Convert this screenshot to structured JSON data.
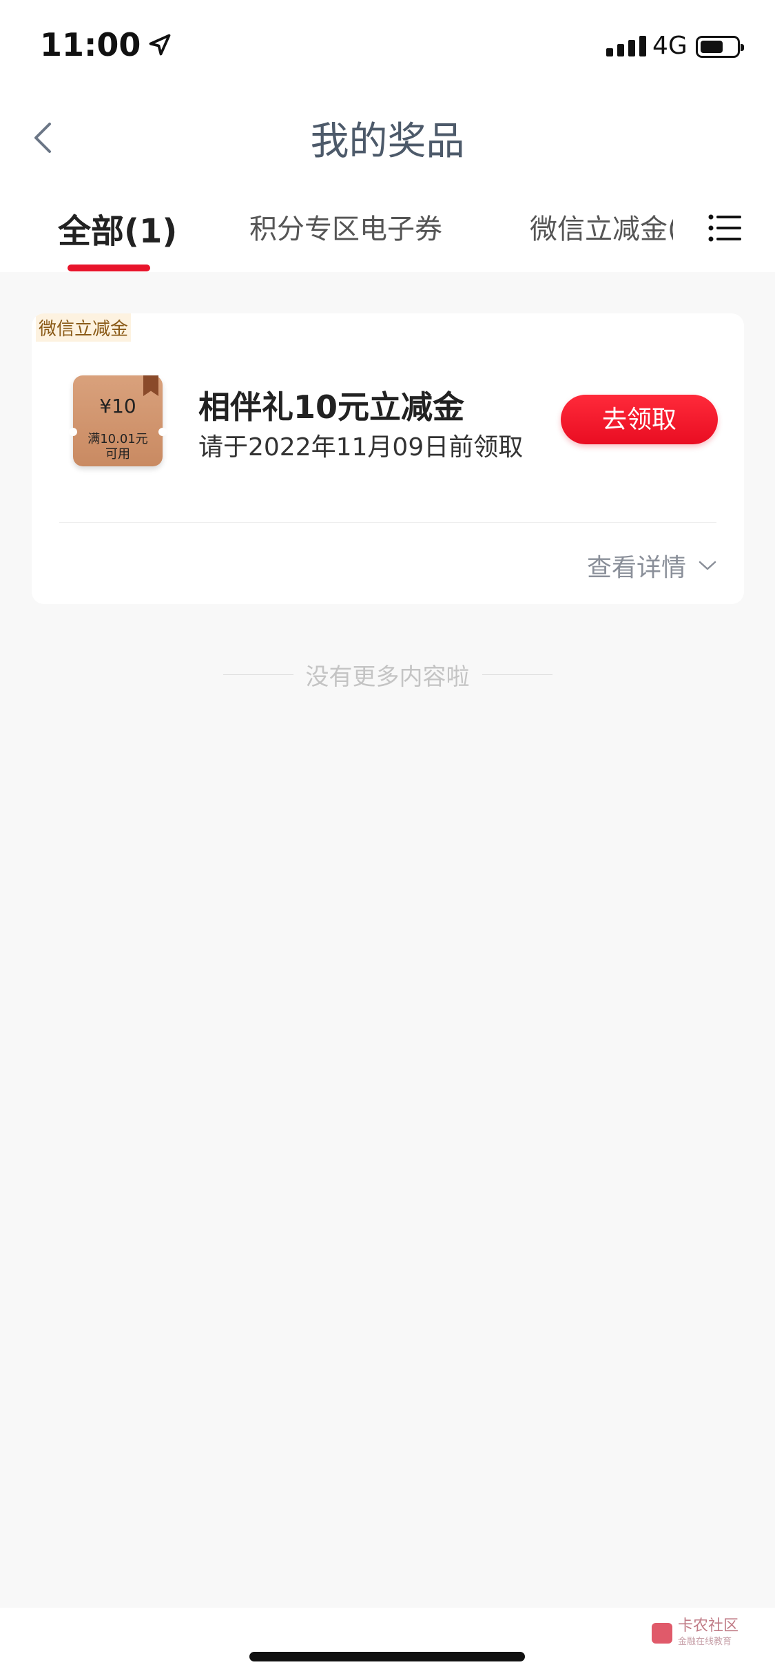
{
  "status_bar": {
    "time": "11:00",
    "network": "4G"
  },
  "nav": {
    "title": "我的奖品"
  },
  "tabs": [
    {
      "label": "全部(1)",
      "active": true
    },
    {
      "label": "积分专区电子券",
      "active": false
    },
    {
      "label": "微信立减金(",
      "active": false
    }
  ],
  "card": {
    "tag": "微信立减金",
    "coupon": {
      "amount": "¥10",
      "condition_line1": "满10.01元",
      "condition_line2": "可用"
    },
    "prize_name": "相伴礼10元立减金",
    "deadline": "请于2022年11月09日前领取",
    "claim_button": "去领取",
    "details_link": "查看详情"
  },
  "footer": {
    "no_more": "没有更多内容啦"
  },
  "watermark": {
    "text": "卡农社区",
    "sub": "金融在线教育"
  },
  "colors": {
    "accent": "#e8142b",
    "coupon": "#d29470"
  }
}
